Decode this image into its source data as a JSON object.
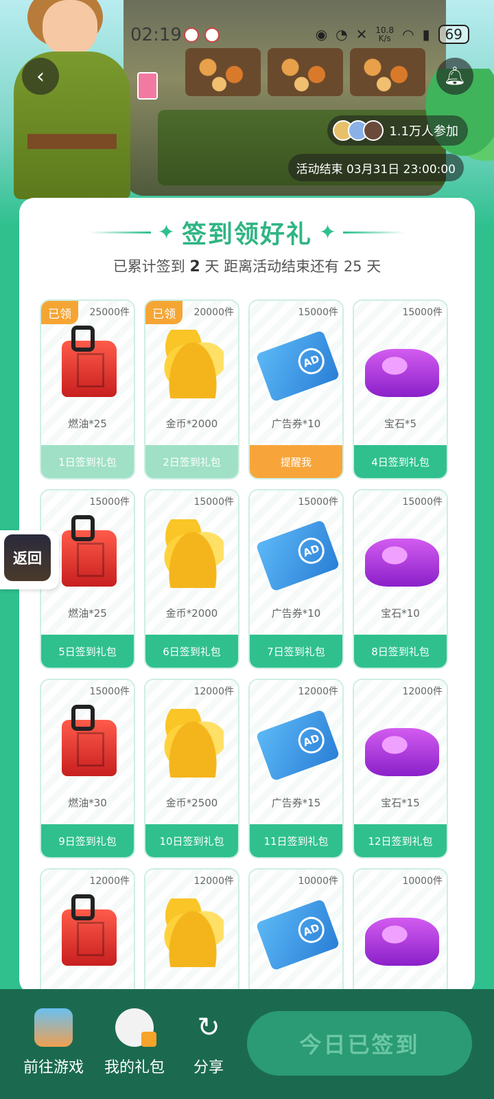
{
  "status_bar": {
    "time": "02:19",
    "net_speed_value": "10.8",
    "net_speed_unit": "K/s",
    "battery": "69"
  },
  "header": {
    "participants": "1.1万人参加",
    "end_time": "活动结束 03月31日 23:00:00"
  },
  "main": {
    "title": "签到领好礼",
    "subtitle_prefix": "已累计签到",
    "signed_days": "2",
    "subtitle_mid": "天  距离活动结束还有 25 天"
  },
  "items": [
    {
      "qty": "25000件",
      "name": "燃油*25",
      "button": "1日签到礼包",
      "claimed": "已领",
      "type": "fuel",
      "state": "claimed"
    },
    {
      "qty": "20000件",
      "name": "金币*2000",
      "button": "2日签到礼包",
      "claimed": "已领",
      "type": "coins",
      "state": "claimed"
    },
    {
      "qty": "15000件",
      "name": "广告券*10",
      "button": "提醒我",
      "claimed": "",
      "type": "ad",
      "state": "remind"
    },
    {
      "qty": "15000件",
      "name": "宝石*5",
      "button": "4日签到礼包",
      "claimed": "",
      "type": "gem",
      "state": "normal"
    },
    {
      "qty": "15000件",
      "name": "燃油*25",
      "button": "5日签到礼包",
      "claimed": "",
      "type": "fuel",
      "state": "normal"
    },
    {
      "qty": "15000件",
      "name": "金币*2000",
      "button": "6日签到礼包",
      "claimed": "",
      "type": "coins",
      "state": "normal"
    },
    {
      "qty": "15000件",
      "name": "广告券*10",
      "button": "7日签到礼包",
      "claimed": "",
      "type": "ad",
      "state": "normal"
    },
    {
      "qty": "15000件",
      "name": "宝石*10",
      "button": "8日签到礼包",
      "claimed": "",
      "type": "gem",
      "state": "normal"
    },
    {
      "qty": "15000件",
      "name": "燃油*30",
      "button": "9日签到礼包",
      "claimed": "",
      "type": "fuel",
      "state": "normal"
    },
    {
      "qty": "12000件",
      "name": "金币*2500",
      "button": "10日签到礼包",
      "claimed": "",
      "type": "coins",
      "state": "normal"
    },
    {
      "qty": "12000件",
      "name": "广告券*15",
      "button": "11日签到礼包",
      "claimed": "",
      "type": "ad",
      "state": "normal"
    },
    {
      "qty": "12000件",
      "name": "宝石*15",
      "button": "12日签到礼包",
      "claimed": "",
      "type": "gem",
      "state": "normal"
    },
    {
      "qty": "12000件",
      "name": "",
      "button": "",
      "claimed": "",
      "type": "fuel",
      "state": "normal"
    },
    {
      "qty": "12000件",
      "name": "",
      "button": "",
      "claimed": "",
      "type": "coins",
      "state": "normal"
    },
    {
      "qty": "10000件",
      "name": "",
      "button": "",
      "claimed": "",
      "type": "ad",
      "state": "normal"
    },
    {
      "qty": "10000件",
      "name": "",
      "button": "",
      "claimed": "",
      "type": "gem",
      "state": "normal"
    }
  ],
  "ad_label": "AD",
  "side_back": "返回",
  "bottom": {
    "goto_game": "前往游戏",
    "my_gifts": "我的礼包",
    "share": "分享",
    "signed_today": "今日已签到"
  },
  "colors": {
    "accent": "#2fc08e",
    "claimed_tag": "#f5a534",
    "remind": "#f7a53a",
    "bottom_bar": "#1b6a4f"
  },
  "icons": {
    "back": "chevron-left-icon",
    "bell": "bell-icon",
    "share": "share-icon"
  }
}
